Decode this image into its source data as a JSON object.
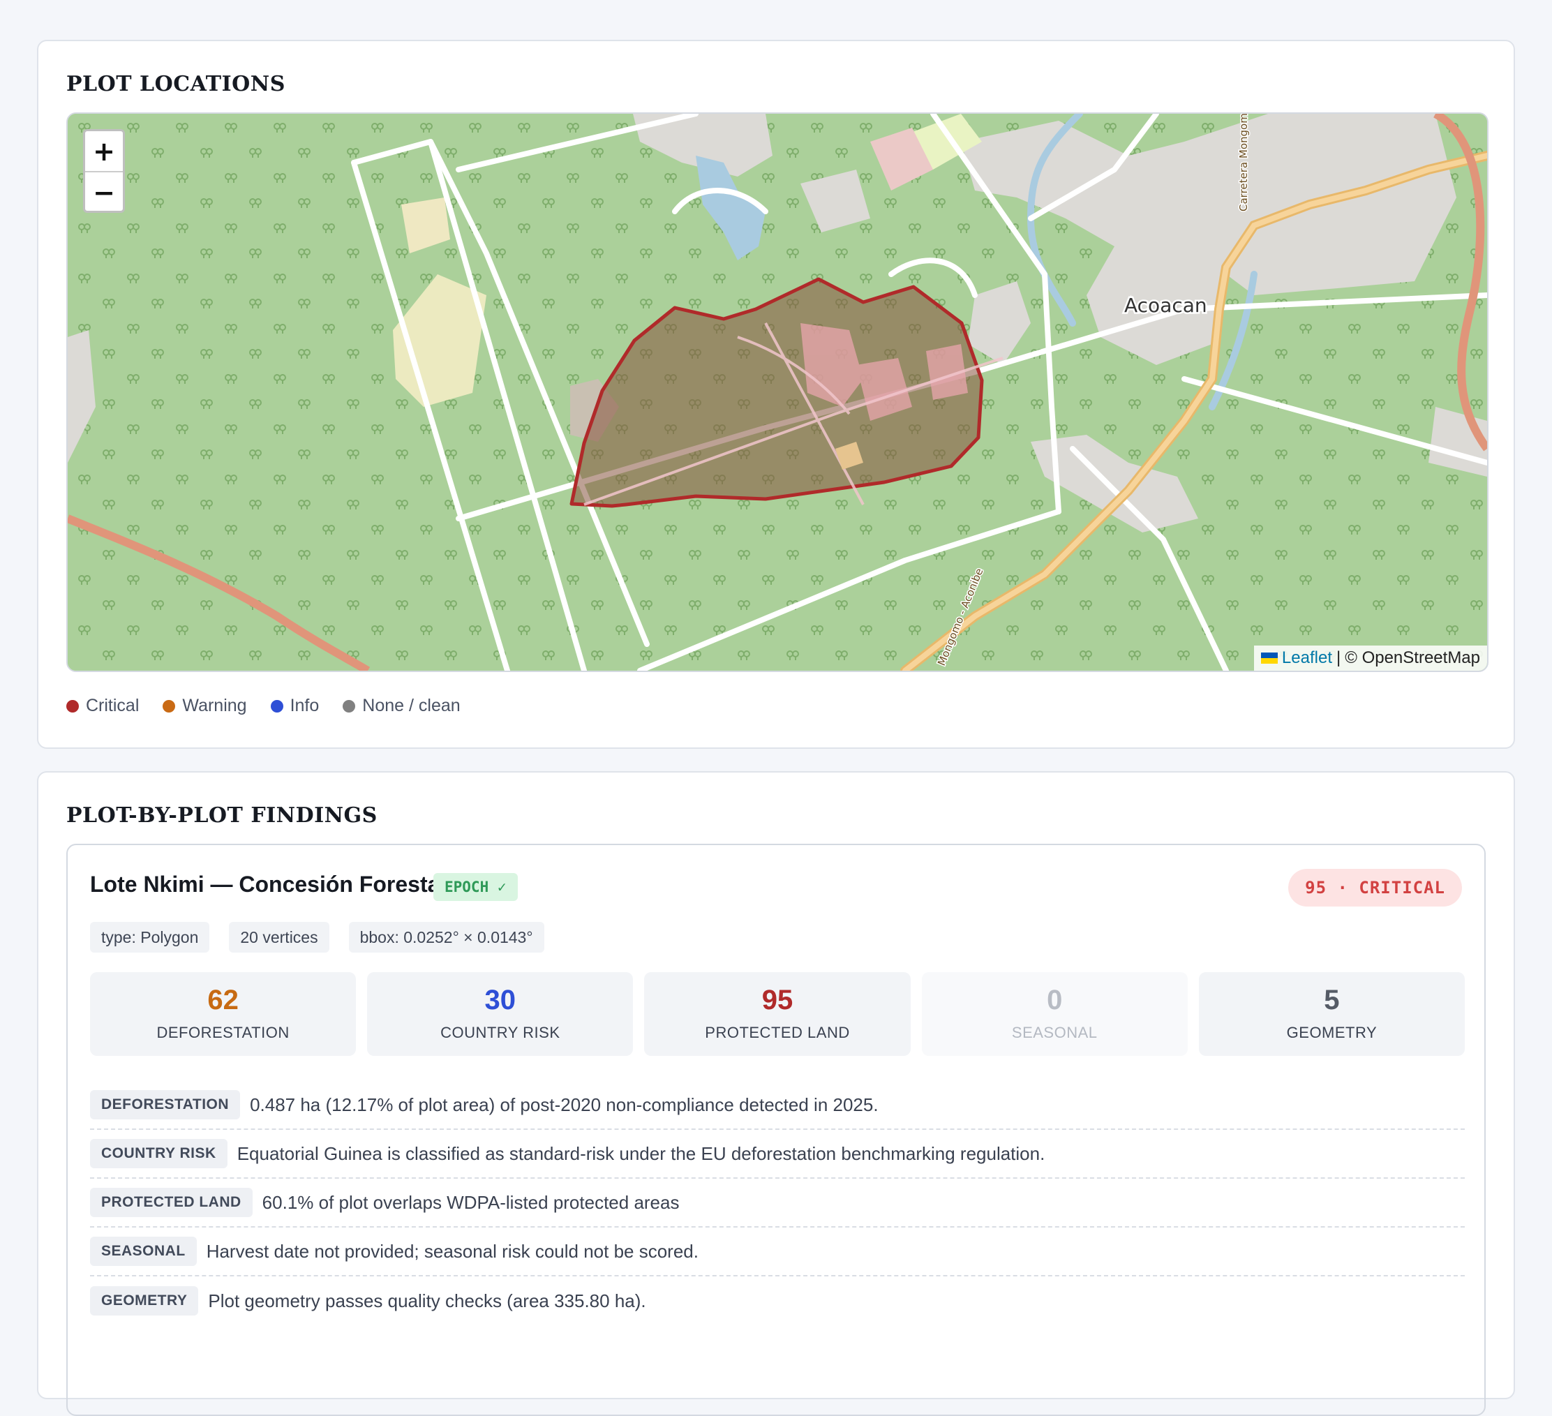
{
  "map_card": {
    "title": "PLOT LOCATIONS",
    "map": {
      "place_label": "Acoacan",
      "road_label_top": "Carretera Mongomo - Aconibe",
      "road_label_bottom": "Mongomo - Aconibe",
      "zoom_in": "+",
      "zoom_out": "−",
      "attribution": {
        "leaflet": "Leaflet",
        "separator": "|",
        "osm": "© OpenStreetMap"
      },
      "polygon_color": "#b02a2a"
    },
    "legend": [
      {
        "label": "Critical",
        "color": "#b02a2a"
      },
      {
        "label": "Warning",
        "color": "#c96a14"
      },
      {
        "label": "Info",
        "color": "#2e4fd6"
      },
      {
        "label": "None / clean",
        "color": "#808080"
      }
    ]
  },
  "findings_card": {
    "title": "PLOT-BY-PLOT FINDINGS",
    "plot": {
      "name": "Lote Nkimi — Concesión Forestal",
      "epoch_badge": "EPOCH ✓",
      "severity_badge": "95 · CRITICAL",
      "tags": [
        "type: Polygon",
        "20 vertices",
        "bbox: 0.0252° × 0.0143°"
      ],
      "scores": [
        {
          "value": "62",
          "label": "DEFORESTATION",
          "color": "#c76a12"
        },
        {
          "value": "30",
          "label": "COUNTRY RISK",
          "color": "#2e4fd6"
        },
        {
          "value": "95",
          "label": "PROTECTED LAND",
          "color": "#b02a2a"
        },
        {
          "value": "0",
          "label": "SEASONAL",
          "color": "#b8bcc4"
        },
        {
          "value": "5",
          "label": "GEOMETRY",
          "color": "#555b66"
        }
      ],
      "findings": [
        {
          "tag": "DEFORESTATION",
          "text": "0.487 ha (12.17% of plot area) of post-2020 non-compliance detected in 2025."
        },
        {
          "tag": "COUNTRY RISK",
          "text": "Equatorial Guinea is classified as standard-risk under the EU deforestation benchmarking regulation."
        },
        {
          "tag": "PROTECTED LAND",
          "text": "60.1% of plot overlaps WDPA-listed protected areas"
        },
        {
          "tag": "SEASONAL",
          "text": "Harvest date not provided; seasonal risk could not be scored."
        },
        {
          "tag": "GEOMETRY",
          "text": "Plot geometry passes quality checks (area 335.80 ha)."
        }
      ]
    }
  }
}
